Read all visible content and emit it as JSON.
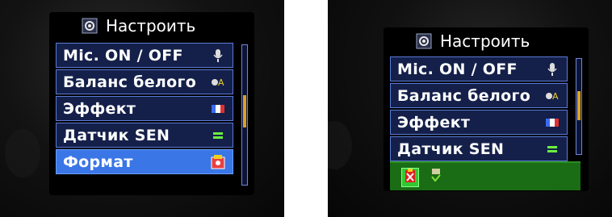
{
  "colors": {
    "row_bg": "#14204a",
    "row_selected_bg": "#3b76e6",
    "row_border": "#5b7bd6",
    "scrollbar_thumb": "#e0a020",
    "confirm_panel_bg": "#1a6d14",
    "text": "#ffffff"
  },
  "left_screen": {
    "title": "Настроить",
    "title_icon": "gear-icon",
    "items": [
      {
        "label": "Mic. ON / OFF",
        "icon": "microphone-icon",
        "selected": false
      },
      {
        "label": "Баланс белого",
        "icon": "white-balance-icon",
        "selected": false
      },
      {
        "label": "Эффект",
        "icon": "color-effect-icon",
        "selected": false
      },
      {
        "label": "Датчик SEN",
        "icon": "sensor-icon",
        "selected": false
      },
      {
        "label": "Формат",
        "icon": "format-icon",
        "selected": true
      }
    ]
  },
  "right_screen": {
    "title": "Настроить",
    "title_icon": "gear-icon",
    "items": [
      {
        "label": "Mic. ON / OFF",
        "icon": "microphone-icon"
      },
      {
        "label": "Баланс белого",
        "icon": "white-balance-icon"
      },
      {
        "label": "Эффект",
        "icon": "color-effect-icon"
      },
      {
        "label": "Датчик SEN",
        "icon": "sensor-icon"
      }
    ],
    "format_panel": {
      "options": [
        {
          "icon": "cancel-format-icon",
          "highlighted": true
        },
        {
          "icon": "confirm-format-icon",
          "highlighted": false
        }
      ]
    }
  }
}
